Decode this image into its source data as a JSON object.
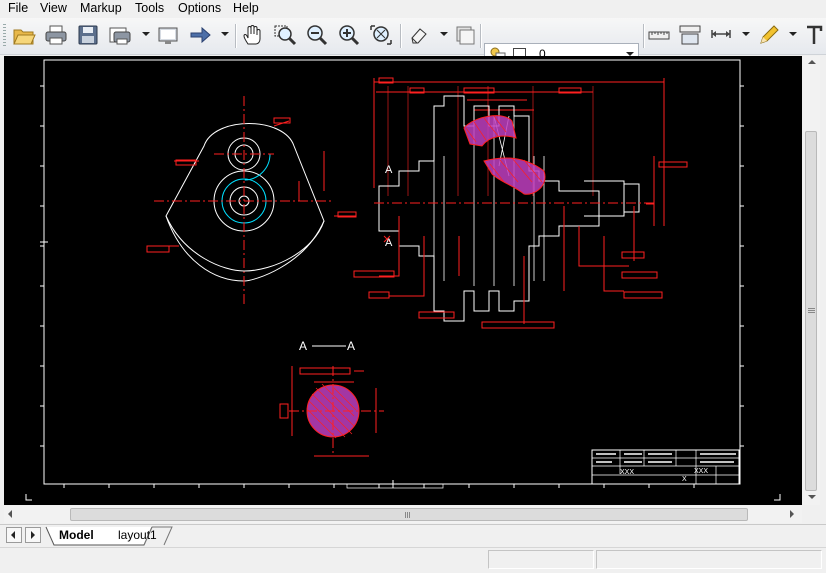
{
  "menu": {
    "file": "File",
    "view": "View",
    "markup": "Markup",
    "tools": "Tools",
    "options": "Options",
    "help": "Help"
  },
  "toolbar": {
    "layer_name": "0",
    "icons": [
      "open-folder-icon",
      "print-icon",
      "save-icon",
      "print-setup-icon",
      "display-icon",
      "arrow-icon",
      "pan-hand-icon",
      "zoom-window-icon",
      "zoom-out-icon",
      "zoom-in-icon",
      "zoom-extents-icon",
      "eraser-icon",
      "layer-icon",
      "layer-state-icon",
      "measure-icon",
      "measure-area-icon",
      "dimension-icon",
      "pencil-icon",
      "text-icon"
    ]
  },
  "drawing": {
    "section_label_1": "A",
    "section_label_2": "A",
    "title_block_code_1": "XXX",
    "title_block_code_2": "XXX",
    "title_block_scale": "X"
  },
  "tabs": {
    "model": "Model",
    "layout1": "layout1"
  },
  "colors": {
    "canvas": "#000000",
    "red": "#ff2020",
    "white": "#ffffff",
    "cyan": "#00e0ff",
    "magenta": "#c040c0"
  }
}
